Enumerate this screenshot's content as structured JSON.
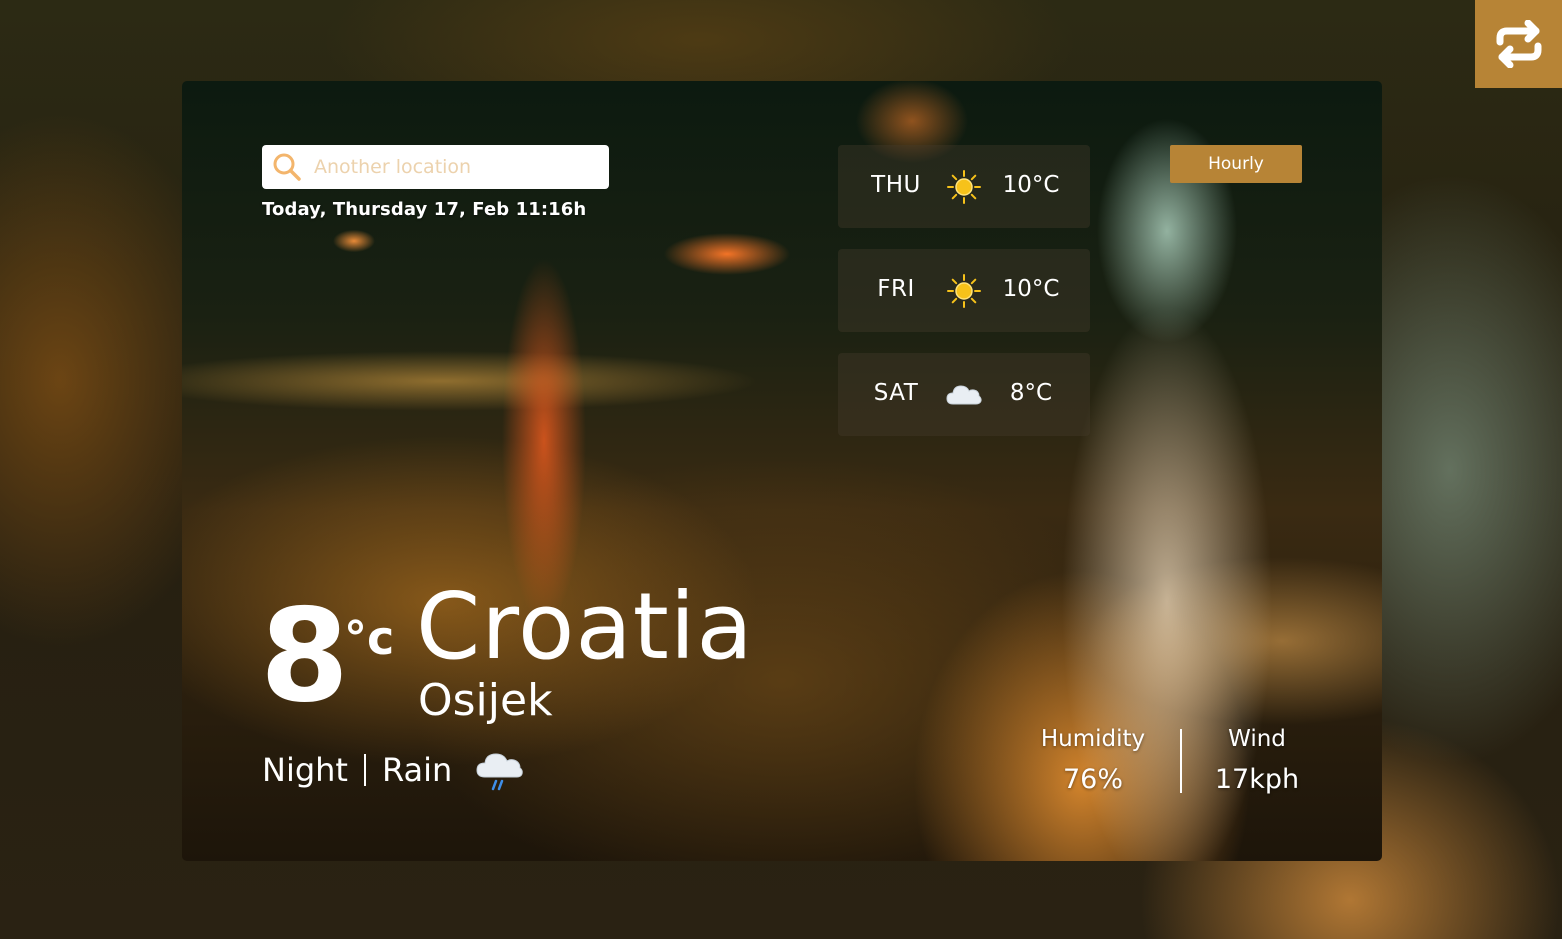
{
  "search": {
    "placeholder": "Another location",
    "value": ""
  },
  "header": {
    "date_line": "Today, Thursday 17, Feb 11:16h"
  },
  "forecast": [
    {
      "day": "THU",
      "icon": "sun-icon",
      "temp": "10°C"
    },
    {
      "day": "FRI",
      "icon": "sun-icon",
      "temp": "10°C"
    },
    {
      "day": "SAT",
      "icon": "cloud-icon",
      "temp": "8°C"
    }
  ],
  "toolbar": {
    "hourly_label": "Hourly"
  },
  "current": {
    "temperature": "8",
    "unit": "°c",
    "country": "Croatia",
    "city": "Osijek",
    "period": "Night",
    "condition": "Rain",
    "condition_icon": "rain-cloud-icon"
  },
  "stats": {
    "humidity_label": "Humidity",
    "humidity_value": "76%",
    "wind_label": "Wind",
    "wind_value": "17kph"
  },
  "colors": {
    "accent": "#b78436",
    "sun": "#f6c21a",
    "rain": "#3f8ee8"
  }
}
